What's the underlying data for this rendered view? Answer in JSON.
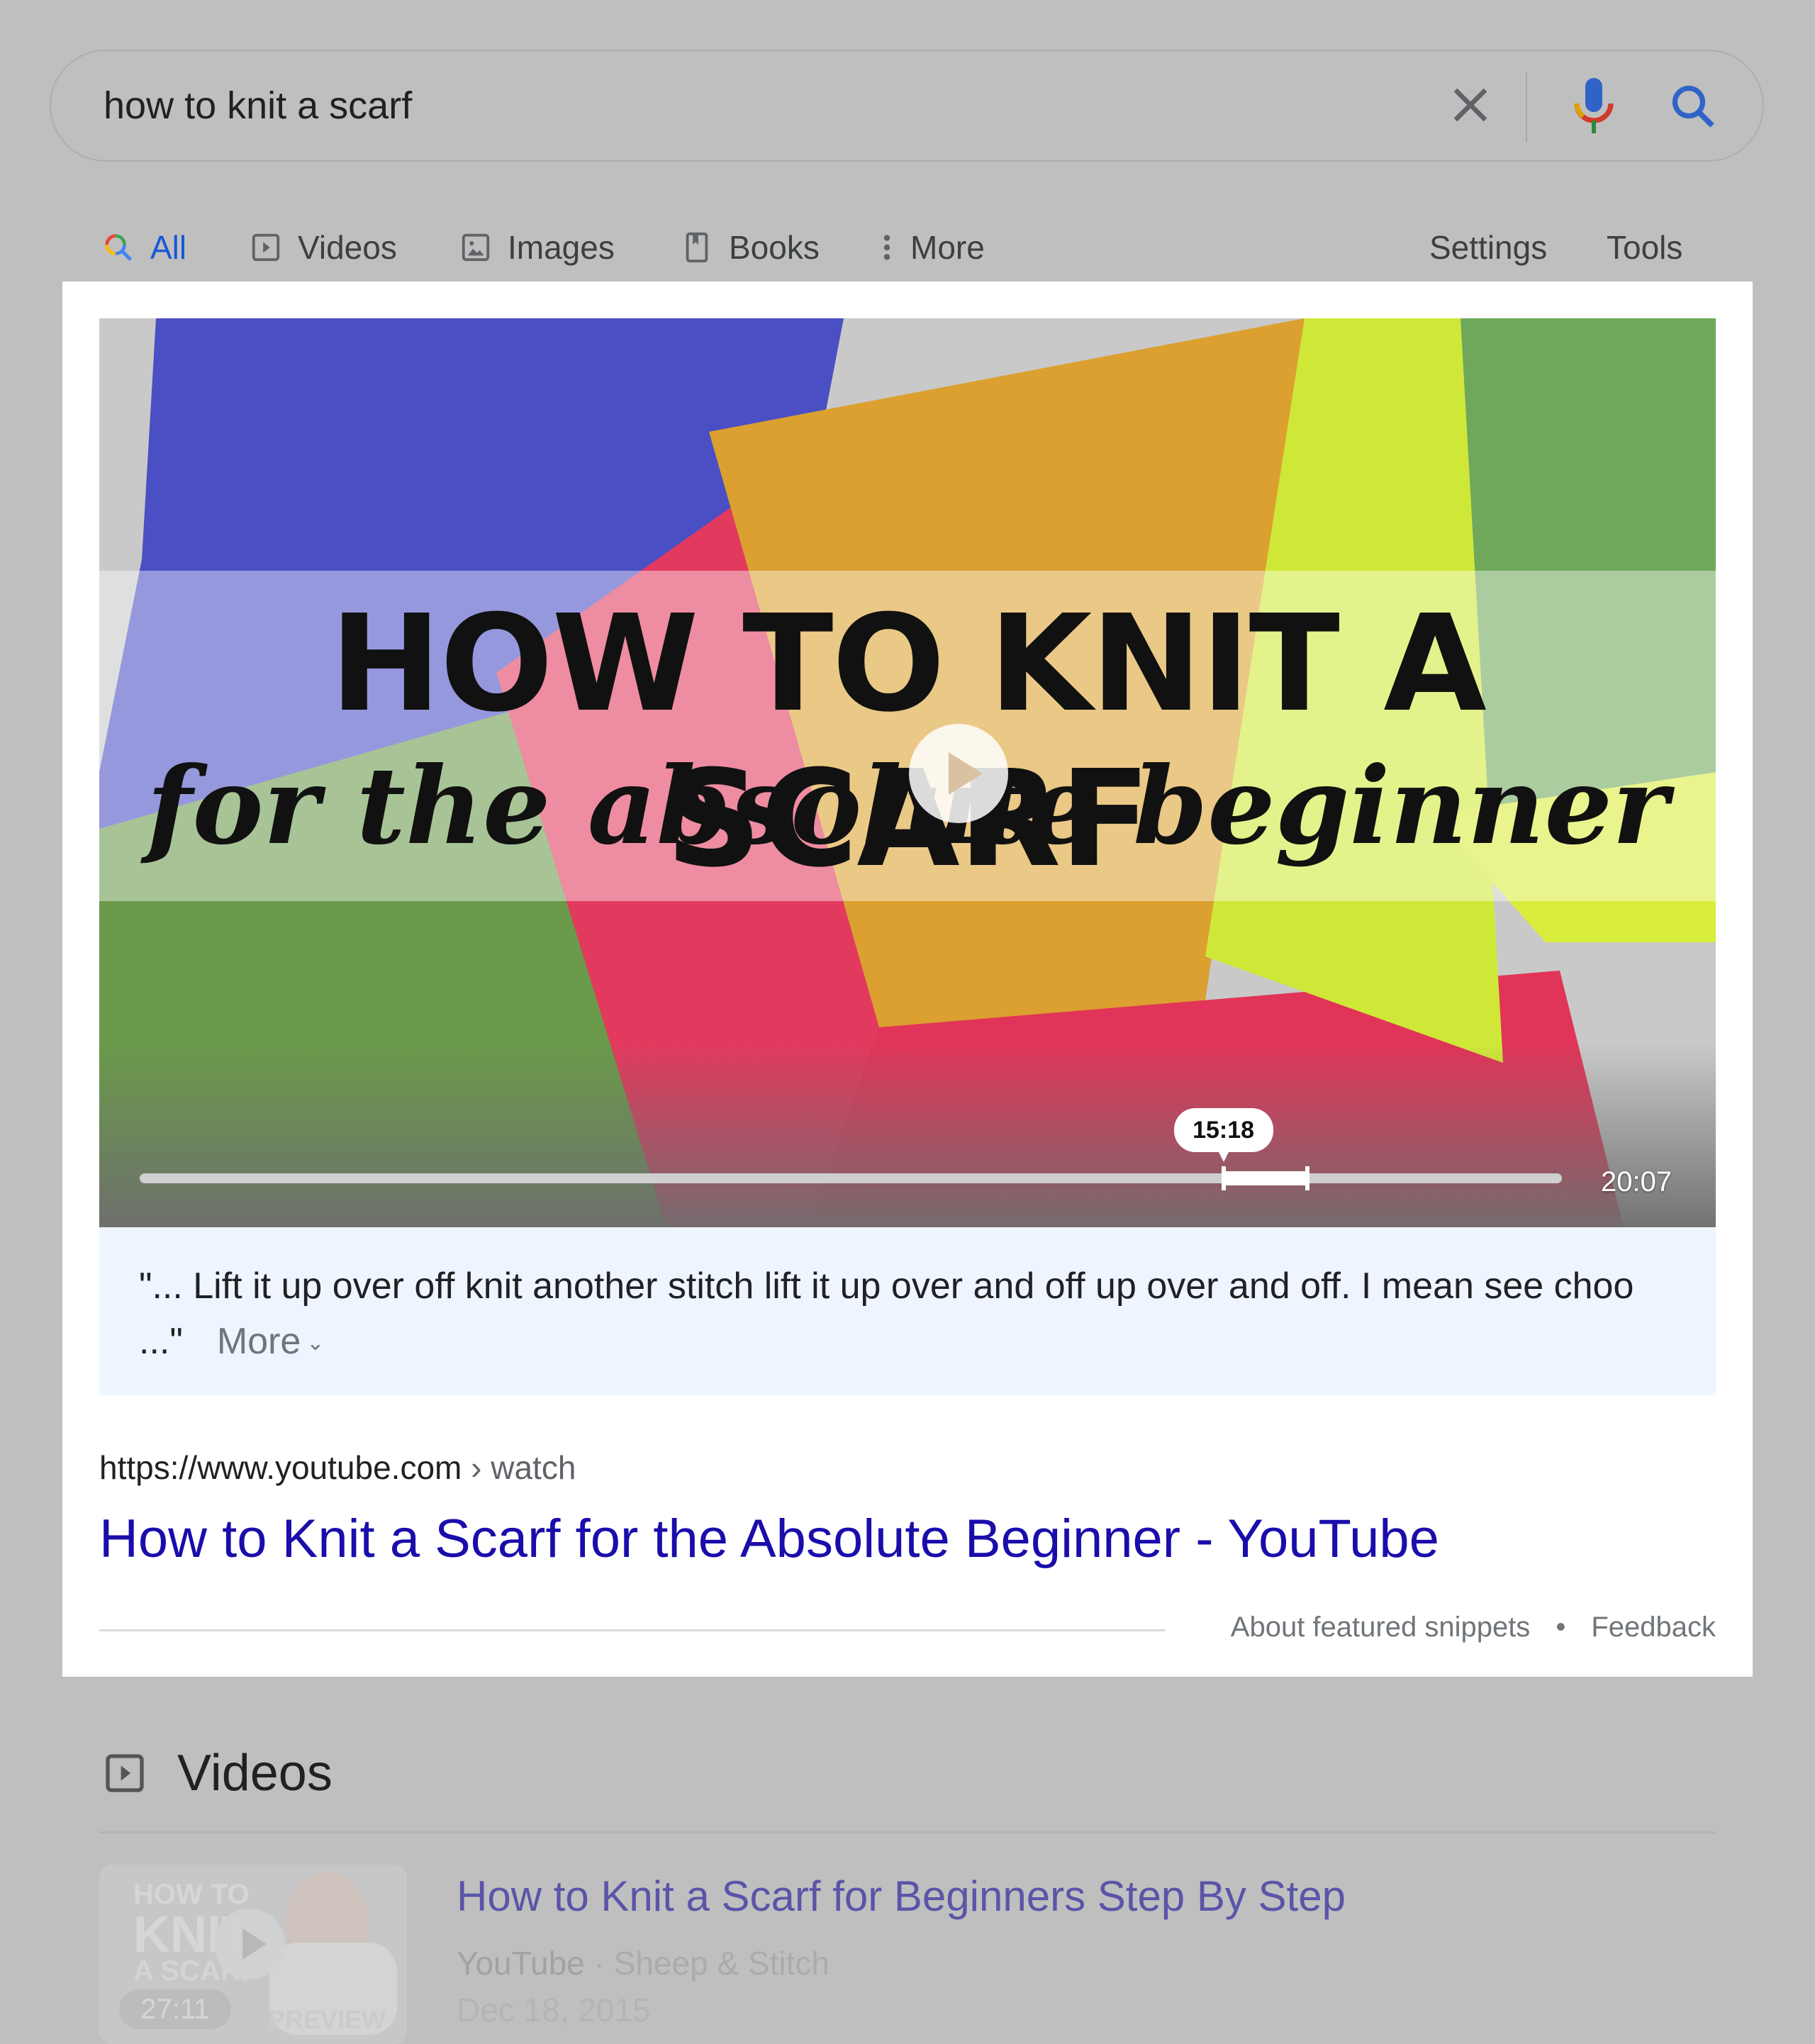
{
  "search": {
    "query": "how to knit a scarf",
    "clear_icon": "close-icon",
    "voice_icon": "microphone-icon",
    "search_icon": "search-icon"
  },
  "tabs": [
    {
      "label": "All",
      "icon": "search-icon",
      "active": true
    },
    {
      "label": "Videos",
      "icon": "video-icon",
      "active": false
    },
    {
      "label": "Images",
      "icon": "image-icon",
      "active": false
    },
    {
      "label": "Books",
      "icon": "book-icon",
      "active": false
    },
    {
      "label": "More",
      "icon": "more-vert-icon",
      "active": false
    }
  ],
  "tools": {
    "settings": "Settings",
    "tools": "Tools"
  },
  "featured_snippet": {
    "video": {
      "overlay_title": "HOW TO KNIT A SCARF",
      "overlay_subtitle": "for the absolute beginner",
      "clip_start": "15:18",
      "duration": "20:07",
      "clip_start_fraction": 0.762,
      "clip_end_fraction": 0.821
    },
    "transcript": "\"... Lift it up over off knit another stitch lift it up over and off up over and off. I mean see choo ...\"",
    "transcript_more": "More",
    "url_domain": "https://www.youtube.com",
    "url_path": "› watch",
    "title": "How to Knit a Scarf for the Absolute Beginner - YouTube",
    "footer": {
      "about": "About featured snippets",
      "separator": "•",
      "feedback": "Feedback"
    }
  },
  "videos_section": {
    "heading": "Videos",
    "items": [
      {
        "title": "How to Knit a Scarf for Beginners Step By Step",
        "source": "YouTube",
        "channel": "· Sheep & Stitch",
        "date": "Dec 18, 2015",
        "duration": "27:11",
        "thumb_text_1": "HOW TO",
        "thumb_text_2": "KNIT",
        "thumb_text_3": "A SCARF",
        "preview_label": "PREVIEW"
      }
    ]
  },
  "colors": {
    "link": "#1a0dab",
    "active_tab": "#1a57d6",
    "transcript_bg": "#eef5ff",
    "page_dim": "#bfbfbf"
  }
}
